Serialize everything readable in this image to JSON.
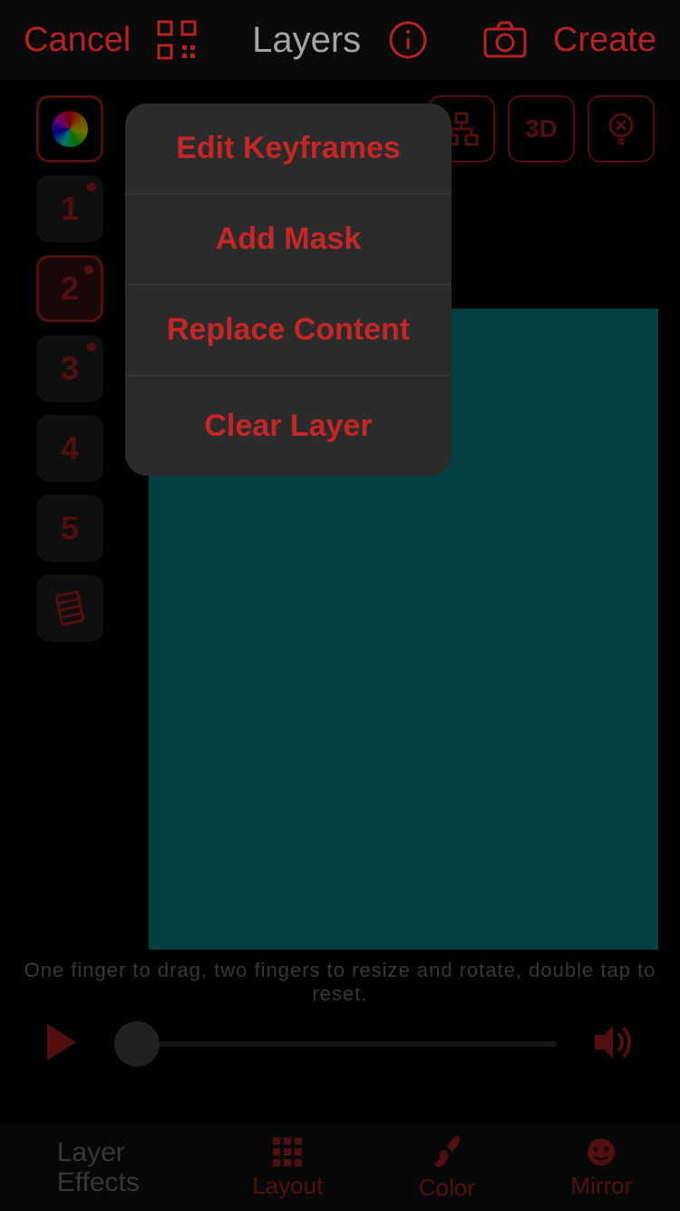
{
  "topbar": {
    "cancel": "Cancel",
    "title": "Layers",
    "create": "Create"
  },
  "sidebar": {
    "layers": [
      {
        "label": "1",
        "has_dot": true
      },
      {
        "label": "2",
        "has_dot": true
      },
      {
        "label": "3",
        "has_dot": true
      },
      {
        "label": "4",
        "has_dot": false
      },
      {
        "label": "5",
        "has_dot": false
      }
    ]
  },
  "toolrow": {
    "three_d": "3D"
  },
  "popover": {
    "items": [
      "Edit Keyframes",
      "Add Mask",
      "Replace Content",
      "Clear Layer"
    ]
  },
  "hint_text": "One finger to drag, two fingers to resize and rotate, double tap to reset.",
  "tabs": {
    "layer_effects": "Layer Effects",
    "layout": "Layout",
    "color": "Color",
    "mirror": "Mirror"
  },
  "colors": {
    "canvas": "#0a8d92",
    "accent": "#b52222"
  }
}
